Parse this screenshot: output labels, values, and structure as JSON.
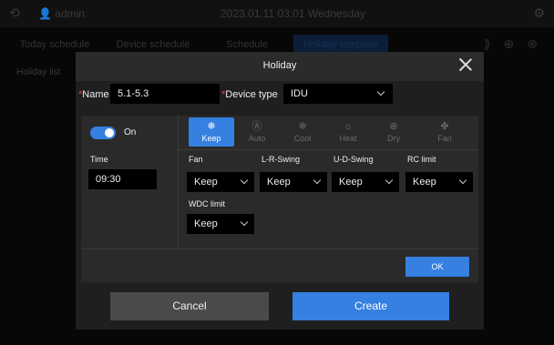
{
  "background": {
    "user_label": "admin",
    "datetime": "2023.01.11  03:01  Wednesday",
    "nav_tabs": [
      "Today schedule",
      "Device schedule",
      "Schedule",
      "Holiday template"
    ],
    "left_list_title": "Holiday list"
  },
  "dialog": {
    "title": "Holiday",
    "name_label": "Name",
    "name_value": "5.1-5.3",
    "device_type_label": "Device type",
    "device_type_value": "IDU",
    "power": {
      "label": "On",
      "enabled": true
    },
    "modes": [
      {
        "label": "Keep",
        "icon": "keep-icon",
        "active": true
      },
      {
        "label": "Auto",
        "icon": "auto-icon",
        "active": false
      },
      {
        "label": "Cool",
        "icon": "snowflake-icon",
        "active": false
      },
      {
        "label": "Heat",
        "icon": "sun-icon",
        "active": false
      },
      {
        "label": "Dry",
        "icon": "droplet-icon",
        "active": false
      },
      {
        "label": "Fan",
        "icon": "fan-icon",
        "active": false
      }
    ],
    "time_label": "Time",
    "time_value": "09:30",
    "fan_label": "Fan",
    "fan_value": "Keep",
    "lr_swing_label": "L-R-Swing",
    "lr_swing_value": "Keep",
    "ud_swing_label": "U-D-Swing",
    "ud_swing_value": "Keep",
    "rc_limit_label": "RC limit",
    "rc_limit_value": "Keep",
    "wdc_limit_label": "WDC limit",
    "wdc_limit_value": "Keep",
    "ok_label": "OK",
    "cancel_label": "Cancel",
    "create_label": "Create"
  },
  "colors": {
    "accent": "#3580e0",
    "required": "#e04040",
    "modal_bg": "#1f1f1f"
  }
}
